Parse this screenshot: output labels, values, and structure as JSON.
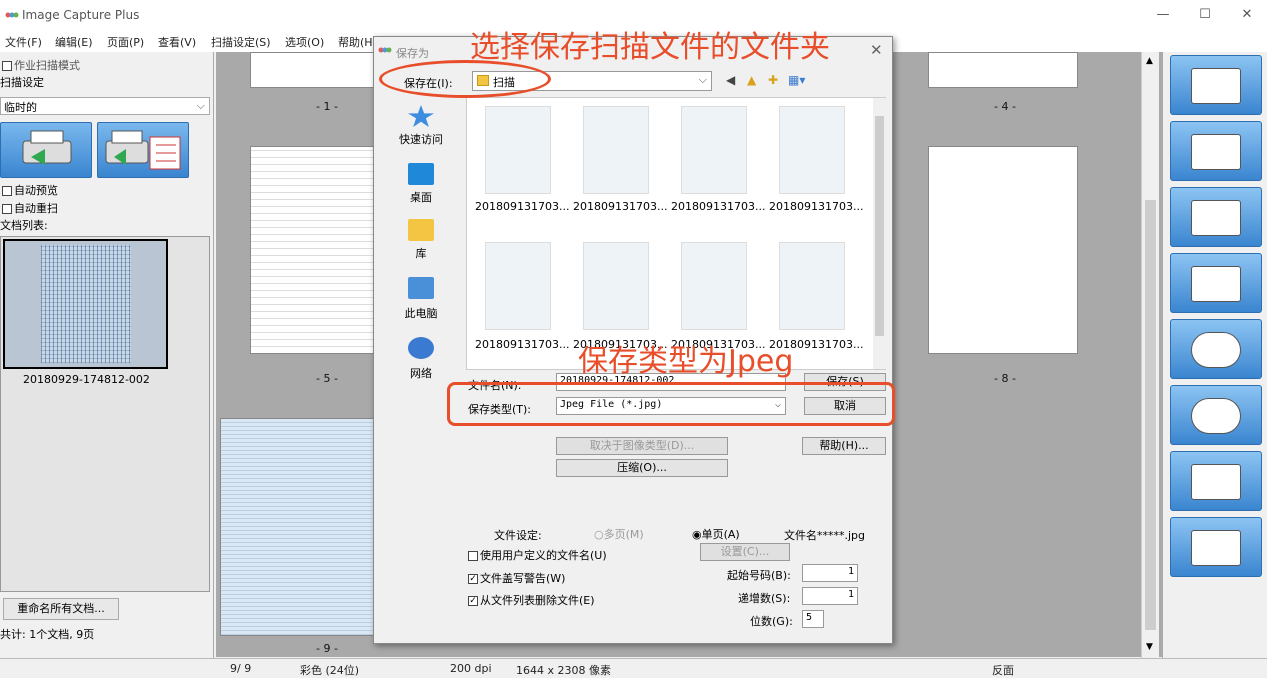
{
  "app": {
    "title": "Image Capture Plus",
    "min": "—",
    "max": "☐",
    "close": "✕"
  },
  "menu": [
    "文件(F)",
    "编辑(E)",
    "页面(P)",
    "查看(V)",
    "扫描设定(S)",
    "选项(O)",
    "帮助(H)"
  ],
  "left": {
    "batch_mode": "作业扫描模式",
    "scan_settings": "扫描设定",
    "scan_select": "临时的",
    "auto_preview": "自动预览",
    "auto_rescan": "自动重扫",
    "doc_list": "文档列表:",
    "doc_name": "20180929-174812-002",
    "rename_btn": "重命名所有文档...",
    "total": "共计:  1个文档,  9页"
  },
  "pages": [
    "- 1 -",
    "- 4 -",
    "- 5 -",
    "- 8 -",
    "- 9 -"
  ],
  "status": {
    "page": "9/  9",
    "color": "彩色 (24位)",
    "dpi": "200 dpi",
    "size": "1644 x  2308 像素",
    "side": "反面"
  },
  "dialog": {
    "title": "保存为",
    "close": "✕",
    "save_in_label": "保存在(I):",
    "save_in_value": "扫描",
    "nav": [
      "快速访问",
      "桌面",
      "库",
      "此电脑",
      "网络"
    ],
    "files": [
      "201809131703...",
      "201809131703...",
      "201809131703...",
      "201809131703...",
      "201809131703...",
      "201809131703...",
      "201809131703...",
      "201809131703..."
    ],
    "filename_label": "文件名(N):",
    "filename_value": "20180929-174812-002",
    "filetype_label": "保存类型(T):",
    "filetype_value": "Jpeg File (*.jpg)",
    "save_btn": "保存(S)",
    "cancel_btn": "取消",
    "depends_btn": "取决于图像类型(D)...",
    "compress_btn": "压缩(O)...",
    "help_btn": "帮助(H)...",
    "file_settings": "文件设定:",
    "multi_page": "多页(M)",
    "single_page": "单页(A)",
    "filename_pattern": "文件名*****.jpg",
    "use_custom": "使用用户定义的文件名(U)",
    "settings_btn": "设置(C)...",
    "overwrite": "文件盖写警告(W)",
    "start_num_label": "起始号码(B):",
    "start_num": "1",
    "remove": "从文件列表删除文件(E)",
    "increment_label": "递增数(S):",
    "increment": "1",
    "digits_label": "位数(G):",
    "digits": "5"
  },
  "annotations": {
    "top": "选择保存扫描文件的文件夹",
    "mid": "保存类型为Jpeg"
  },
  "colors": {
    "accent": "#e84e2a",
    "button_blue": "#3a85d0"
  }
}
